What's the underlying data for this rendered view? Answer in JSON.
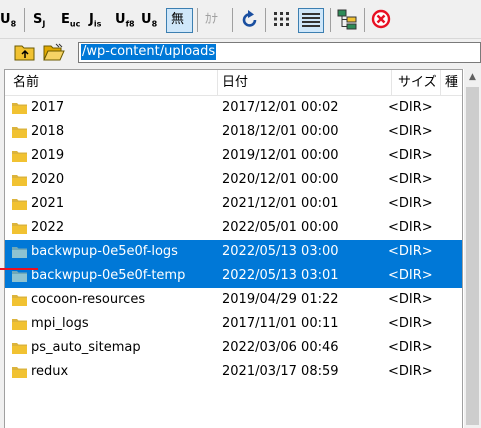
{
  "toolbar": {
    "buttons": [
      {
        "label": "U",
        "sub": "8"
      },
      {
        "label": "S",
        "sub": "J"
      },
      {
        "label": "E",
        "sub": "uc"
      },
      {
        "label": "J",
        "sub": "is"
      },
      {
        "label": "U",
        "sub": "f8"
      },
      {
        "label": "U",
        "sub": "8"
      }
    ],
    "mu_label": "無",
    "ka_label": "ｶﾅ",
    "colors": {
      "accent": "#0078d7",
      "red": "#e81123",
      "green": "#2e8b57"
    }
  },
  "pathbar": {
    "path": "/wp-content/uploads"
  },
  "columns": {
    "name": "名前",
    "date": "日付",
    "size": "サイズ",
    "type": "種"
  },
  "files": [
    {
      "name": "2017",
      "date": "2017/12/01 00:02",
      "size": "<DIR>",
      "selected": false
    },
    {
      "name": "2018",
      "date": "2018/12/01 00:00",
      "size": "<DIR>",
      "selected": false
    },
    {
      "name": "2019",
      "date": "2019/12/01 00:00",
      "size": "<DIR>",
      "selected": false
    },
    {
      "name": "2020",
      "date": "2020/12/01 00:00",
      "size": "<DIR>",
      "selected": false
    },
    {
      "name": "2021",
      "date": "2021/12/01 00:01",
      "size": "<DIR>",
      "selected": false
    },
    {
      "name": "2022",
      "date": "2022/05/01 00:00",
      "size": "<DIR>",
      "selected": false
    },
    {
      "name": "backwpup-0e5e0f-logs",
      "date": "2022/05/13 03:00",
      "size": "<DIR>",
      "selected": true
    },
    {
      "name": "backwpup-0e5e0f-temp",
      "date": "2022/05/13 03:01",
      "size": "<DIR>",
      "selected": true
    },
    {
      "name": "cocoon-resources",
      "date": "2019/04/29 01:22",
      "size": "<DIR>",
      "selected": false
    },
    {
      "name": "mpi_logs",
      "date": "2017/11/01 00:11",
      "size": "<DIR>",
      "selected": false
    },
    {
      "name": "ps_auto_sitemap",
      "date": "2022/03/06 00:46",
      "size": "<DIR>",
      "selected": false
    },
    {
      "name": "redux",
      "date": "2021/03/17 08:59",
      "size": "<DIR>",
      "selected": false
    }
  ]
}
